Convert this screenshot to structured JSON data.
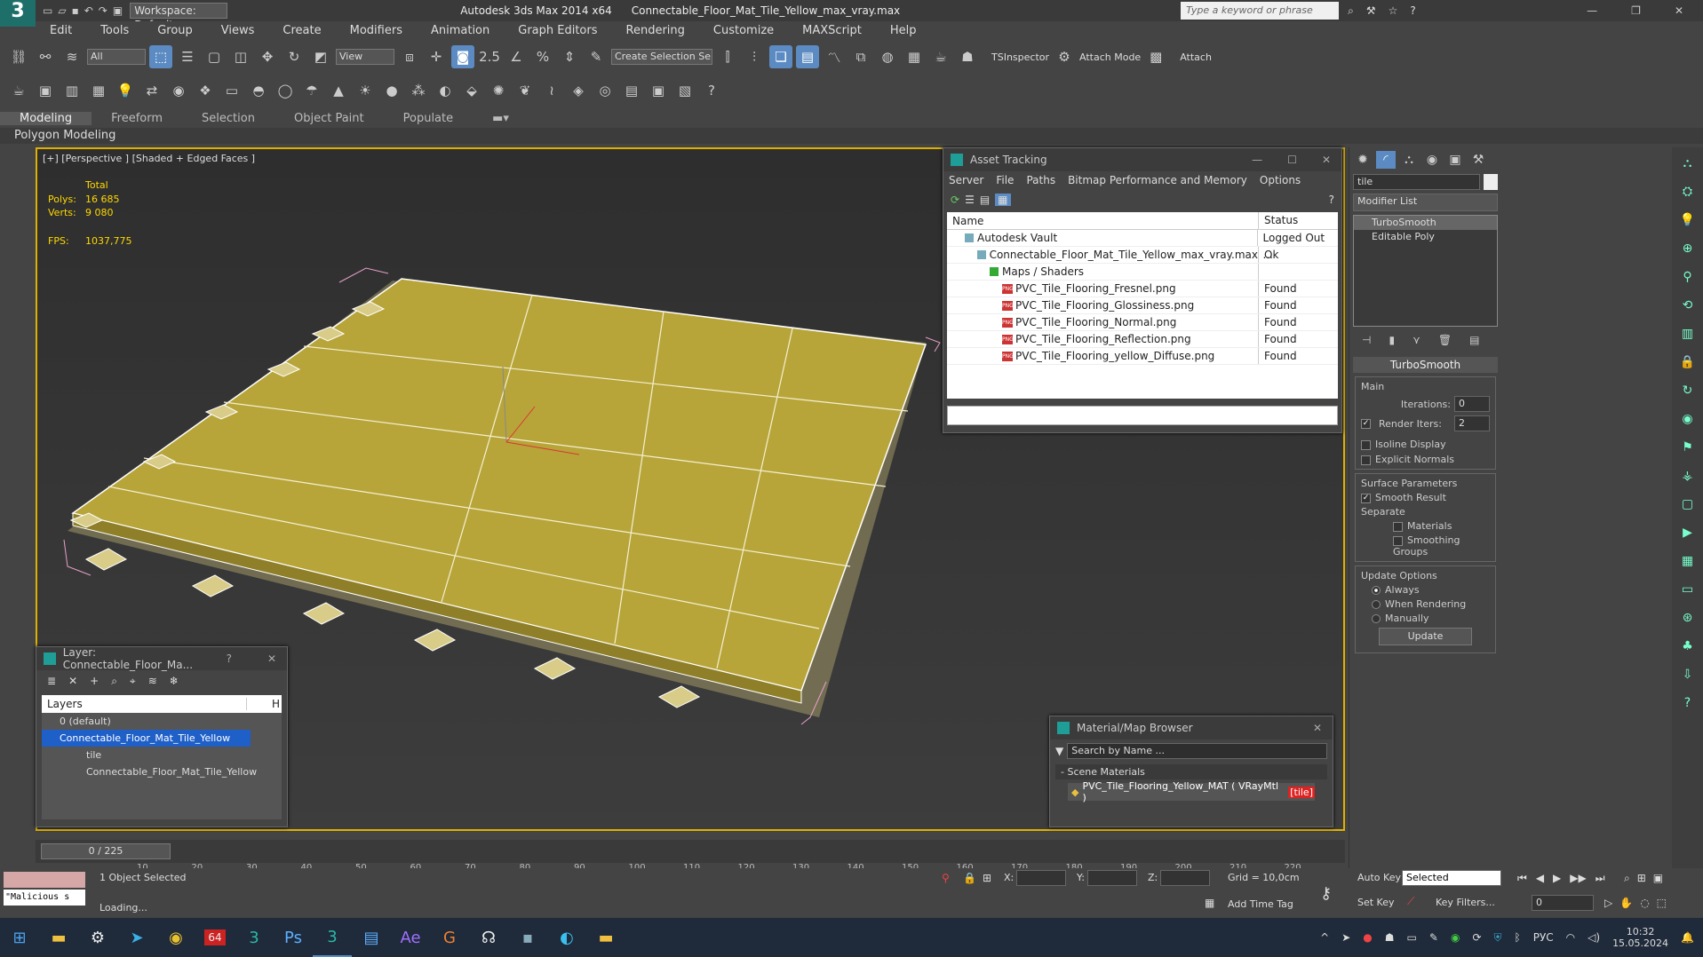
{
  "app": {
    "title": "Autodesk 3ds Max 2014 x64",
    "file": "Connectable_Floor_Mat_Tile_Yellow_max_vray.max",
    "workspace": "Workspace: Default",
    "search_placeholder": "Type a keyword or phrase"
  },
  "menu": [
    "Edit",
    "Tools",
    "Group",
    "Views",
    "Create",
    "Modifiers",
    "Animation",
    "Graph Editors",
    "Rendering",
    "Customize",
    "MAXScript",
    "Help"
  ],
  "toolbar": {
    "filter": "All",
    "ref_coord": "View",
    "snap_value": "2.5",
    "selection_set": "Create Selection Se",
    "ts_inspector": "TSInspector",
    "attach_mode": "Attach Mode",
    "attach": "Attach"
  },
  "ribbon": {
    "tabs": [
      "Modeling",
      "Freeform",
      "Selection",
      "Object Paint",
      "Populate"
    ],
    "active": "Modeling",
    "sub": "Polygon Modeling"
  },
  "viewport": {
    "label": "[+] [Perspective ] [Shaded + Edged Faces ]",
    "total": "Total",
    "polys_label": "Polys:",
    "polys": "16 685",
    "verts_label": "Verts:",
    "verts": "9 080",
    "fps_label": "FPS:",
    "fps": "1037,775"
  },
  "asset_tracking": {
    "title": "Asset Tracking",
    "menu": [
      "Server",
      "File",
      "Paths",
      "Bitmap Performance and Memory",
      "Options"
    ],
    "col_name": "Name",
    "col_status": "Status",
    "rows": [
      {
        "name": "Autodesk Vault",
        "status": "Logged Out ...",
        "indent": 1
      },
      {
        "name": "Connectable_Floor_Mat_Tile_Yellow_max_vray.max",
        "status": "Ok",
        "indent": 2
      },
      {
        "name": "Maps / Shaders",
        "status": "",
        "indent": 3
      },
      {
        "name": "PVC_Tile_Flooring_Fresnel.png",
        "status": "Found",
        "indent": 4
      },
      {
        "name": "PVC_Tile_Flooring_Glossiness.png",
        "status": "Found",
        "indent": 4
      },
      {
        "name": "PVC_Tile_Flooring_Normal.png",
        "status": "Found",
        "indent": 4
      },
      {
        "name": "PVC_Tile_Flooring_Reflection.png",
        "status": "Found",
        "indent": 4
      },
      {
        "name": "PVC_Tile_Flooring_yellow_Diffuse.png",
        "status": "Found",
        "indent": 4
      }
    ]
  },
  "layer": {
    "title": "Layer: Connectable_Floor_Ma...",
    "help": "?",
    "col": "Layers",
    "col2": "H",
    "items": [
      "0 (default)",
      "Connectable_Floor_Mat_Tile_Yellow",
      "tile",
      "Connectable_Floor_Mat_Tile_Yellow"
    ]
  },
  "material_browser": {
    "title": "Material/Map Browser",
    "search_placeholder": "Search by Name ...",
    "section": "- Scene Materials",
    "material": "PVC_Tile_Flooring_Yellow_MAT  ( VRayMtl )",
    "material_tag": "[tile]"
  },
  "command_panel": {
    "object_name": "tile",
    "modifier_list": "Modifier List",
    "stack": [
      "TurboSmooth",
      "Editable Poly"
    ],
    "rollout": "TurboSmooth",
    "main": "Main",
    "iterations_label": "Iterations:",
    "iterations": "0",
    "render_iters_label": "Render Iters:",
    "render_iters": "2",
    "isoline": "Isoline Display",
    "explicit": "Explicit Normals",
    "surface": "Surface Parameters",
    "smooth_result": "Smooth Result",
    "separate": "Separate",
    "materials": "Materials",
    "smoothing_groups": "Smoothing Groups",
    "update_options": "Update Options",
    "always": "Always",
    "when_rendering": "When Rendering",
    "manually": "Manually",
    "update": "Update"
  },
  "timeline": {
    "frame": "0 / 225",
    "ticks": [
      "10",
      "20",
      "30",
      "40",
      "50",
      "60",
      "70",
      "80",
      "90",
      "100",
      "110",
      "120",
      "130",
      "140",
      "150",
      "160",
      "170",
      "180",
      "190",
      "200",
      "210",
      "220"
    ]
  },
  "status": {
    "selected": "1 Object Selected",
    "loading": "Loading...",
    "x": "X:",
    "y": "Y:",
    "z": "Z:",
    "grid": "Grid = 10,0cm",
    "add_time_tag": "Add Time Tag",
    "auto_key": "Auto Key",
    "set_key": "Set Key",
    "selected_combo": "Selected",
    "key_filters": "Key Filters...",
    "frame_field": "0",
    "script": "\"Malicious s"
  },
  "taskbar": {
    "lang": "РУС",
    "time": "10:32",
    "date": "15.05.2024",
    "badge": "64"
  },
  "colors": {
    "accent": "#5b8bc2",
    "highlight": "#e0b000",
    "floor": "#b7a53a"
  }
}
